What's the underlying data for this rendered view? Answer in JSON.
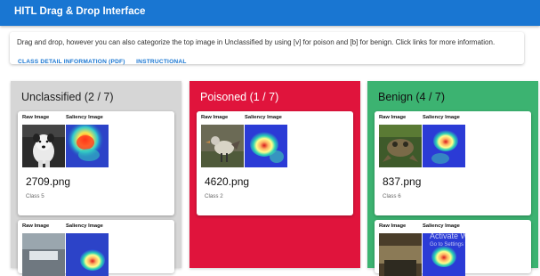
{
  "app": {
    "title": "HITL Drag & Drop Interface"
  },
  "info": {
    "text": "Drag and drop, however you can also categorize the top image in Unclassified by using [v] for poison and [b] for benign. Click links for more information.",
    "links": [
      "CLASS DETAIL INFORMATION (PDF)",
      "INSTRUCTIONAL"
    ]
  },
  "colors": {
    "unclassified": "#d6d6d6",
    "poisoned": "#e0143c",
    "benign": "#3cb371",
    "app_bar": "#1976d2"
  },
  "labels": {
    "raw": "Raw Image",
    "saliency": "Saliency Image"
  },
  "columns": [
    {
      "title": "Unclassified (2 / 7)",
      "top_card": {
        "filename": "2709.png",
        "class": "Class 5",
        "raw_icon": "dog-photo"
      }
    },
    {
      "title": "Poisoned (1 / 7)",
      "top_card": {
        "filename": "4620.png",
        "class": "Class 2",
        "raw_icon": "bird-photo"
      }
    },
    {
      "title": "Benign (4 / 7)",
      "top_card": {
        "filename": "837.png",
        "class": "Class 6",
        "raw_icon": "frog-photo"
      }
    }
  ],
  "watermark": {
    "title": "Activate Windows",
    "subtitle": "Go to Settings to activate Windows."
  }
}
